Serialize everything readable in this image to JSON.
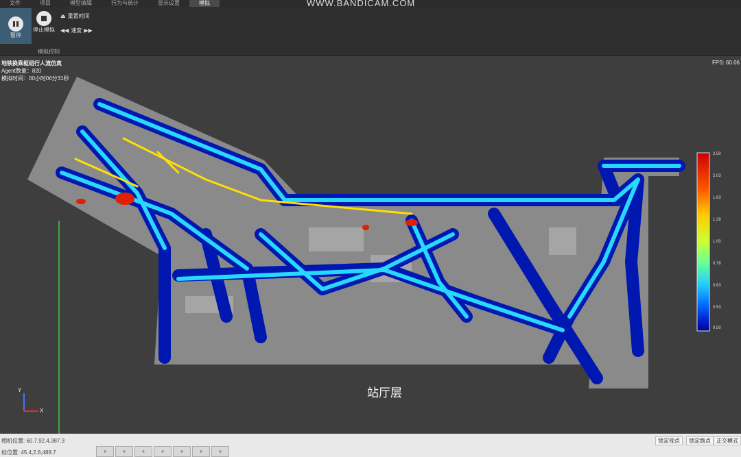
{
  "menu": {
    "items": [
      "文件",
      "项目",
      "模型编辑",
      "行为与统计",
      "显示设置",
      "模拟"
    ],
    "active": "模拟"
  },
  "watermark": "WWW.BANDICAM.COM",
  "ribbon": {
    "pause_label": "暂停",
    "stop_label": "停止模拟",
    "reset_time_label": "重置时间",
    "speed_label": "速度",
    "group_label": "模拟控制"
  },
  "viewport": {
    "title": "地铁换乘枢纽行人流仿真",
    "agent_count": "Agent数量：820",
    "sim_time": "模拟时间：00小时06分31秒",
    "fps": "FPS: 60.06",
    "floor_label": "站厅层",
    "axis_y": "Y",
    "axis_x": "X"
  },
  "legend": {
    "ticks": [
      "2.50",
      "2.03",
      "1.63",
      "1.28",
      "1.00",
      "0.78",
      "0.63",
      "0.53",
      "0.50"
    ],
    "colors": [
      "#cc0000",
      "#ff5500",
      "#ffcc00",
      "#ccff33",
      "#66ff99",
      "#22ccff",
      "#0066ff",
      "#0022cc",
      "#000099"
    ]
  },
  "status": {
    "camera_pos": "相机位置: 60.7,92.4,387.3",
    "cursor_pos": "标位置: 45.4,2.8,488.7",
    "btn_lock_view": "锁定视点",
    "btn_lock_target": "锁定路点",
    "btn_ortho": "正交模式"
  },
  "colors": {
    "density_low": "#0018b0",
    "density_mid": "#28d8ff",
    "density_high": "#ffe000",
    "density_peak": "#e02000"
  }
}
